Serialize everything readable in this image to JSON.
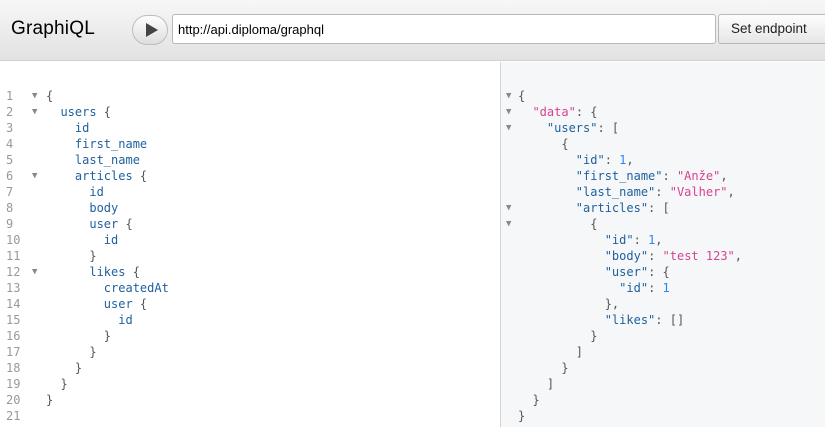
{
  "header": {
    "title": "GraphiQL",
    "endpoint_value": "http://api.diploma/graphql",
    "set_endpoint_label": "Set endpoint"
  },
  "query": {
    "lines": [
      {
        "n": "1",
        "fold": true,
        "segs": [
          {
            "t": "{",
            "c": "punc"
          }
        ]
      },
      {
        "n": "2",
        "fold": true,
        "segs": [
          {
            "t": "  ",
            "c": ""
          },
          {
            "t": "users",
            "c": "field"
          },
          {
            "t": " {",
            "c": "punc"
          }
        ]
      },
      {
        "n": "3",
        "fold": false,
        "segs": [
          {
            "t": "    ",
            "c": ""
          },
          {
            "t": "id",
            "c": "field"
          }
        ]
      },
      {
        "n": "4",
        "fold": false,
        "segs": [
          {
            "t": "    ",
            "c": ""
          },
          {
            "t": "first_name",
            "c": "field"
          }
        ]
      },
      {
        "n": "5",
        "fold": false,
        "segs": [
          {
            "t": "    ",
            "c": ""
          },
          {
            "t": "last_name",
            "c": "field"
          }
        ]
      },
      {
        "n": "6",
        "fold": true,
        "segs": [
          {
            "t": "    ",
            "c": ""
          },
          {
            "t": "articles",
            "c": "field"
          },
          {
            "t": " {",
            "c": "punc"
          }
        ]
      },
      {
        "n": "7",
        "fold": false,
        "segs": [
          {
            "t": "      ",
            "c": ""
          },
          {
            "t": "id",
            "c": "field"
          }
        ]
      },
      {
        "n": "8",
        "fold": false,
        "segs": [
          {
            "t": "      ",
            "c": ""
          },
          {
            "t": "body",
            "c": "field"
          }
        ]
      },
      {
        "n": "9",
        "fold": false,
        "segs": [
          {
            "t": "      ",
            "c": ""
          },
          {
            "t": "user",
            "c": "field"
          },
          {
            "t": " {",
            "c": "punc"
          }
        ]
      },
      {
        "n": "10",
        "fold": false,
        "segs": [
          {
            "t": "        ",
            "c": ""
          },
          {
            "t": "id",
            "c": "field"
          }
        ]
      },
      {
        "n": "11",
        "fold": false,
        "segs": [
          {
            "t": "      }",
            "c": "punc"
          }
        ]
      },
      {
        "n": "12",
        "fold": true,
        "segs": [
          {
            "t": "      ",
            "c": ""
          },
          {
            "t": "likes",
            "c": "field"
          },
          {
            "t": " {",
            "c": "punc"
          }
        ]
      },
      {
        "n": "13",
        "fold": false,
        "segs": [
          {
            "t": "        ",
            "c": ""
          },
          {
            "t": "createdAt",
            "c": "field"
          }
        ]
      },
      {
        "n": "14",
        "fold": false,
        "segs": [
          {
            "t": "        ",
            "c": ""
          },
          {
            "t": "user",
            "c": "field"
          },
          {
            "t": " {",
            "c": "punc"
          }
        ]
      },
      {
        "n": "15",
        "fold": false,
        "segs": [
          {
            "t": "          ",
            "c": ""
          },
          {
            "t": "id",
            "c": "field"
          }
        ]
      },
      {
        "n": "16",
        "fold": false,
        "segs": [
          {
            "t": "        }",
            "c": "punc"
          }
        ]
      },
      {
        "n": "17",
        "fold": false,
        "segs": [
          {
            "t": "      }",
            "c": "punc"
          }
        ]
      },
      {
        "n": "18",
        "fold": false,
        "segs": [
          {
            "t": "    }",
            "c": "punc"
          }
        ]
      },
      {
        "n": "19",
        "fold": false,
        "segs": [
          {
            "t": "  }",
            "c": "punc"
          }
        ]
      },
      {
        "n": "20",
        "fold": false,
        "segs": [
          {
            "t": "}",
            "c": "punc"
          }
        ]
      },
      {
        "n": "21",
        "fold": false,
        "segs": []
      }
    ]
  },
  "result": {
    "lines": [
      {
        "fold": true,
        "segs": [
          {
            "t": "{",
            "c": "punc"
          }
        ]
      },
      {
        "fold": true,
        "segs": [
          {
            "t": "  ",
            "c": ""
          },
          {
            "t": "\"data\"",
            "c": "str"
          },
          {
            "t": ": {",
            "c": "punc"
          }
        ]
      },
      {
        "fold": true,
        "segs": [
          {
            "t": "    ",
            "c": ""
          },
          {
            "t": "\"users\"",
            "c": "key"
          },
          {
            "t": ": [",
            "c": "punc"
          }
        ]
      },
      {
        "fold": false,
        "segs": [
          {
            "t": "      {",
            "c": "punc"
          }
        ]
      },
      {
        "fold": false,
        "segs": [
          {
            "t": "        ",
            "c": ""
          },
          {
            "t": "\"id\"",
            "c": "key"
          },
          {
            "t": ": ",
            "c": "punc"
          },
          {
            "t": "1",
            "c": "num"
          },
          {
            "t": ",",
            "c": "punc"
          }
        ]
      },
      {
        "fold": false,
        "segs": [
          {
            "t": "        ",
            "c": ""
          },
          {
            "t": "\"first_name\"",
            "c": "key"
          },
          {
            "t": ": ",
            "c": "punc"
          },
          {
            "t": "\"Anže\"",
            "c": "str"
          },
          {
            "t": ",",
            "c": "punc"
          }
        ]
      },
      {
        "fold": false,
        "segs": [
          {
            "t": "        ",
            "c": ""
          },
          {
            "t": "\"last_name\"",
            "c": "key"
          },
          {
            "t": ": ",
            "c": "punc"
          },
          {
            "t": "\"Valher\"",
            "c": "str"
          },
          {
            "t": ",",
            "c": "punc"
          }
        ]
      },
      {
        "fold": true,
        "segs": [
          {
            "t": "        ",
            "c": ""
          },
          {
            "t": "\"articles\"",
            "c": "key"
          },
          {
            "t": ": [",
            "c": "punc"
          }
        ]
      },
      {
        "fold": true,
        "segs": [
          {
            "t": "          {",
            "c": "punc"
          }
        ]
      },
      {
        "fold": false,
        "segs": [
          {
            "t": "            ",
            "c": ""
          },
          {
            "t": "\"id\"",
            "c": "key"
          },
          {
            "t": ": ",
            "c": "punc"
          },
          {
            "t": "1",
            "c": "num"
          },
          {
            "t": ",",
            "c": "punc"
          }
        ]
      },
      {
        "fold": false,
        "segs": [
          {
            "t": "            ",
            "c": ""
          },
          {
            "t": "\"body\"",
            "c": "key"
          },
          {
            "t": ": ",
            "c": "punc"
          },
          {
            "t": "\"test 123\"",
            "c": "str"
          },
          {
            "t": ",",
            "c": "punc"
          }
        ]
      },
      {
        "fold": false,
        "segs": [
          {
            "t": "            ",
            "c": ""
          },
          {
            "t": "\"user\"",
            "c": "key"
          },
          {
            "t": ": {",
            "c": "punc"
          }
        ]
      },
      {
        "fold": false,
        "segs": [
          {
            "t": "              ",
            "c": ""
          },
          {
            "t": "\"id\"",
            "c": "key"
          },
          {
            "t": ": ",
            "c": "punc"
          },
          {
            "t": "1",
            "c": "num"
          }
        ]
      },
      {
        "fold": false,
        "segs": [
          {
            "t": "            },",
            "c": "punc"
          }
        ]
      },
      {
        "fold": false,
        "segs": [
          {
            "t": "            ",
            "c": ""
          },
          {
            "t": "\"likes\"",
            "c": "key"
          },
          {
            "t": ": []",
            "c": "punc"
          }
        ]
      },
      {
        "fold": false,
        "segs": [
          {
            "t": "          }",
            "c": "punc"
          }
        ]
      },
      {
        "fold": false,
        "segs": [
          {
            "t": "        ]",
            "c": "punc"
          }
        ]
      },
      {
        "fold": false,
        "segs": [
          {
            "t": "      }",
            "c": "punc"
          }
        ]
      },
      {
        "fold": false,
        "segs": [
          {
            "t": "    ]",
            "c": "punc"
          }
        ]
      },
      {
        "fold": false,
        "segs": [
          {
            "t": "  }",
            "c": "punc"
          }
        ]
      },
      {
        "fold": false,
        "segs": [
          {
            "t": "}",
            "c": "punc"
          }
        ]
      }
    ]
  },
  "icons": {
    "run": "play-icon",
    "fold": "fold-arrow-icon"
  }
}
